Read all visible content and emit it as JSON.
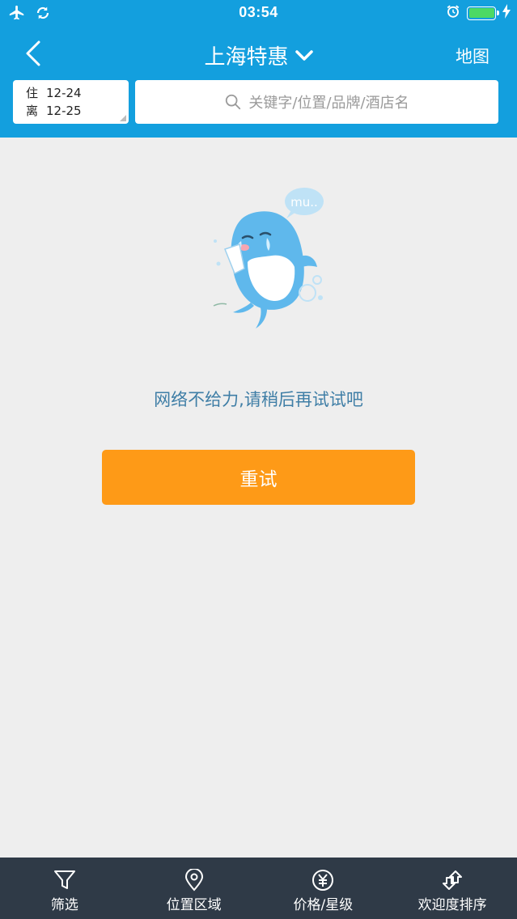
{
  "status_bar": {
    "time": "03:54",
    "left_icons": [
      "airplane-icon",
      "sync-icon"
    ],
    "right_icons": [
      "alarm-icon",
      "battery-icon",
      "charging-icon"
    ],
    "battery_fill": 1.0
  },
  "header": {
    "title": "上海特惠",
    "map_label": "地图",
    "checkin_label": "住",
    "checkin_date": "12-24",
    "checkout_label": "离",
    "checkout_date": "12-25",
    "search_placeholder": "关键字/位置/品牌/酒店名"
  },
  "main": {
    "mascot_bubble_text": "mu..",
    "error_message": "网络不给力,请稍后再试试吧",
    "retry_label": "重试"
  },
  "tab_bar": {
    "items": [
      {
        "label": "筛选",
        "icon": "filter-icon"
      },
      {
        "label": "位置区域",
        "icon": "location-pin-icon"
      },
      {
        "label": "价格/星级",
        "icon": "yen-icon"
      },
      {
        "label": "欢迎度排序",
        "icon": "sort-icon"
      }
    ]
  },
  "colors": {
    "header_bg": "#139fde",
    "retry_button": "#fe9a17",
    "tab_bar_bg": "#2f3a47",
    "error_text": "#3f7ea6",
    "page_bg": "#eeeeee"
  }
}
